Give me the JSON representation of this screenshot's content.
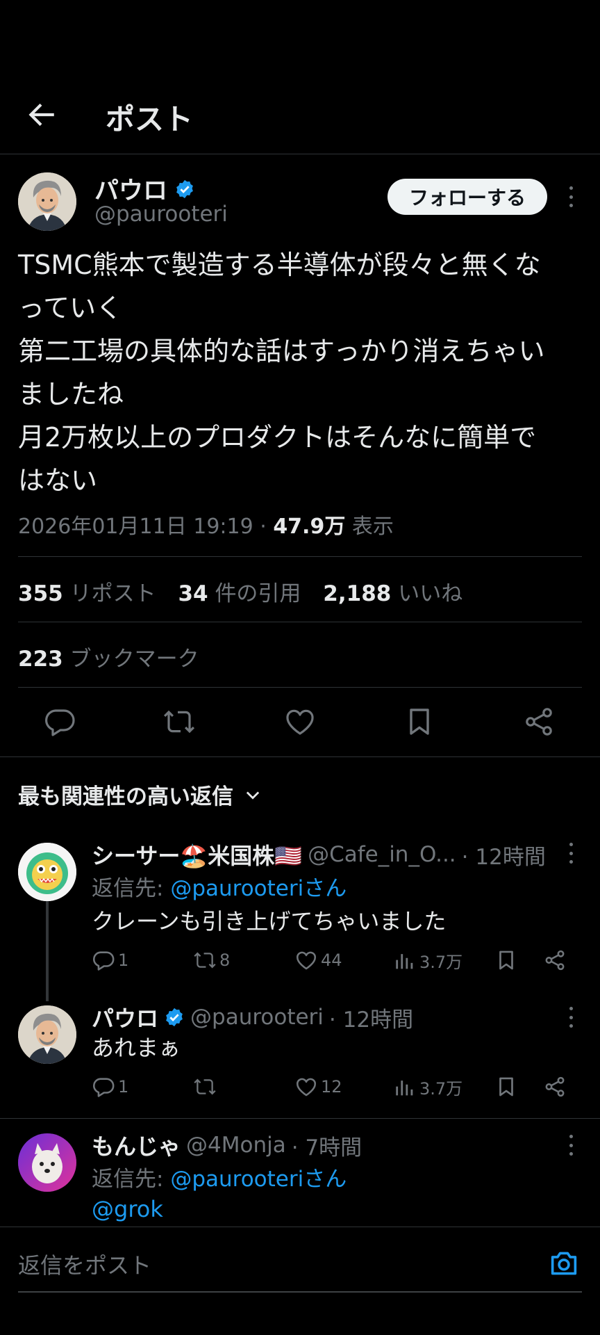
{
  "header": {
    "title": "ポスト"
  },
  "post": {
    "author_name": "パウロ",
    "author_handle": "@paurooteri",
    "follow_label": "フォローする",
    "text": "TSMC熊本で製造する半導体が段々と無くな\nっていく\n第二工場の具体的な話はすっかり消えちゃい\nましたね\n月2万枚以上のプロダクトはそんなに簡単で\nはない",
    "datetime": "2026年01月11日 19:19",
    "views_count": "47.9万",
    "views_label": "表示",
    "reposts_count": "355",
    "reposts_label": "リポスト",
    "quotes_count": "34",
    "quotes_label": "件の引用",
    "likes_count": "2,188",
    "likes_label": "いいね",
    "bookmarks_count": "223",
    "bookmarks_label": "ブックマーク"
  },
  "sort_label": "最も関連性の高い返信",
  "replies": [
    {
      "name": "シーサー🏖️米国株🇺🇸",
      "handle": "@Cafe_in_O...",
      "time": "· 12時間",
      "reply_to_prefix": "返信先: ",
      "reply_to_handle": "@paurooteri",
      "reply_to_suffix": "さん",
      "text": "クレーンも引き上げてちゃいました",
      "replies": "1",
      "reposts": "8",
      "likes": "44",
      "views": "3.7万"
    },
    {
      "name": "パウロ",
      "handle": "@paurooteri",
      "time": "· 12時間",
      "text": "あれまぁ",
      "replies": "1",
      "reposts": "",
      "likes": "12",
      "views": "3.7万"
    },
    {
      "name": "もんじゃ",
      "handle": "@4Monja",
      "time": "· 7時間",
      "reply_to_prefix": "返信先: ",
      "reply_to_handle": "@paurooteri",
      "reply_to_suffix": "さん",
      "text": "@grok"
    }
  ],
  "composer": {
    "placeholder": "返信をポスト"
  },
  "colors": {
    "accent": "#1d9bf0",
    "background": "#000000",
    "muted": "#71767b",
    "text": "#e7e9ea"
  }
}
